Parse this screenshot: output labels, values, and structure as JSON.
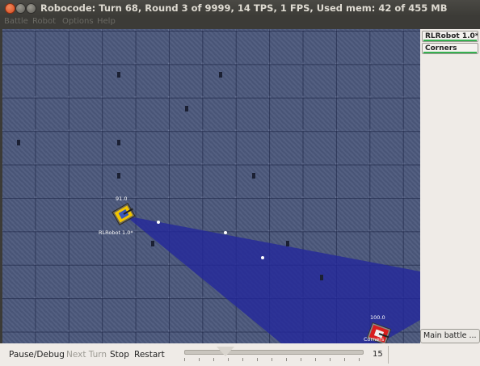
{
  "window": {
    "title": "Robocode: Turn 68, Round 3 of 9999, 14 TPS, 1 FPS, Used mem: 42 of 455 MB"
  },
  "menubar": {
    "items": [
      {
        "label": "Battle"
      },
      {
        "label": "Robot"
      },
      {
        "label": "Options"
      },
      {
        "label": "Help"
      }
    ]
  },
  "arena": {
    "robots": [
      {
        "name": "RLRobot 1.0*",
        "energy": "91.0",
        "color": "#f2c500"
      },
      {
        "name": "Corners",
        "energy": "100.0",
        "color": "#d81e1e"
      }
    ],
    "radar_color": "#23279c"
  },
  "sidebar": {
    "robots": [
      {
        "label": "RLRobot 1.0*"
      },
      {
        "label": "Corners"
      }
    ],
    "main_battle_label": "Main battle ..."
  },
  "controls": {
    "pause_label": "Pause/Debug",
    "next_turn_label": "Next Turn",
    "stop_label": "Stop",
    "restart_label": "Restart",
    "speed_value": "15"
  }
}
